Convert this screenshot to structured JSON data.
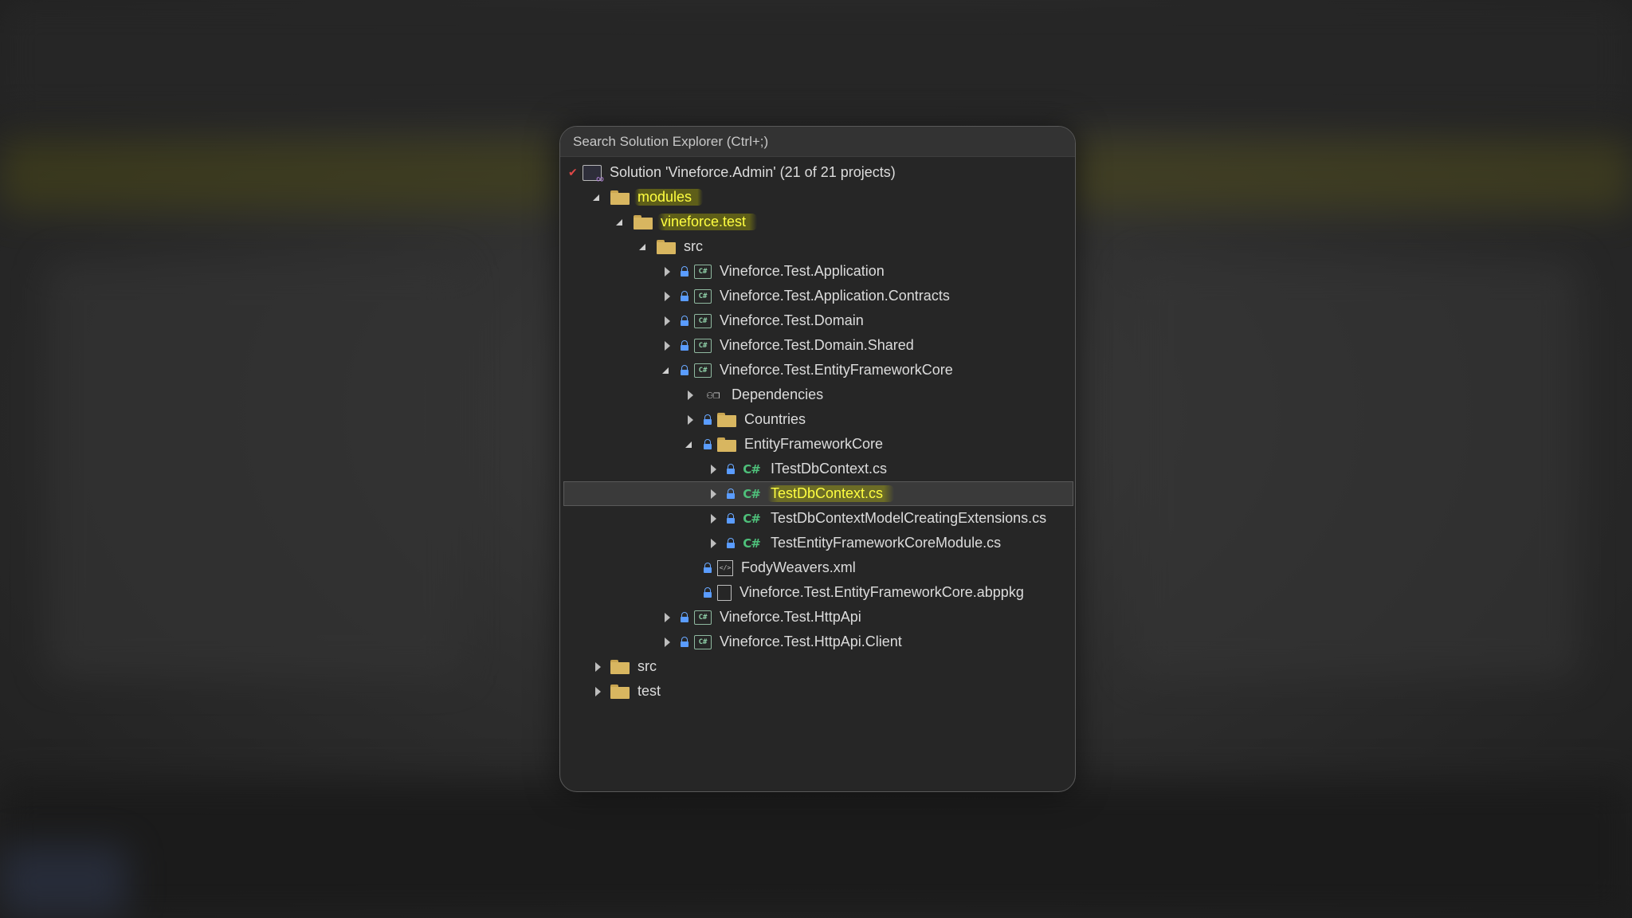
{
  "search": {
    "placeholder": "Search Solution Explorer (Ctrl+;)"
  },
  "tree": [
    {
      "label": "Solution 'Vineforce.Admin' (21 of 21 projects)",
      "icon": "solution-icon",
      "expand": "none",
      "lock": false,
      "level": 0,
      "check": true
    },
    {
      "label": "modules",
      "icon": "folder-icon",
      "expand": "expanded",
      "lock": false,
      "level": 1,
      "highlight": true
    },
    {
      "label": "vineforce.test",
      "icon": "folder-icon",
      "expand": "expanded",
      "lock": false,
      "level": 2,
      "highlight": true
    },
    {
      "label": "src",
      "icon": "folder-icon",
      "expand": "expanded",
      "lock": false,
      "level": 3
    },
    {
      "label": "Vineforce.Test.Application",
      "icon": "csproj-icon",
      "expand": "collapsed",
      "lock": true,
      "level": 4
    },
    {
      "label": "Vineforce.Test.Application.Contracts",
      "icon": "csproj-icon",
      "expand": "collapsed",
      "lock": true,
      "level": 4
    },
    {
      "label": "Vineforce.Test.Domain",
      "icon": "csproj-icon",
      "expand": "collapsed",
      "lock": true,
      "level": 4
    },
    {
      "label": "Vineforce.Test.Domain.Shared",
      "icon": "csproj-icon",
      "expand": "collapsed",
      "lock": true,
      "level": 4
    },
    {
      "label": "Vineforce.Test.EntityFrameworkCore",
      "icon": "csproj-icon",
      "expand": "expanded",
      "lock": true,
      "level": 4
    },
    {
      "label": "Dependencies",
      "icon": "dependencies-icon",
      "expand": "collapsed",
      "lock": false,
      "level": 5
    },
    {
      "label": "Countries",
      "icon": "folder-icon",
      "expand": "collapsed",
      "lock": true,
      "level": 5
    },
    {
      "label": "EntityFrameworkCore",
      "icon": "folder-icon",
      "expand": "expanded",
      "lock": true,
      "level": 5
    },
    {
      "label": "ITestDbContext.cs",
      "icon": "csharp-file-icon",
      "expand": "collapsed",
      "lock": true,
      "level": 6
    },
    {
      "label": "TestDbContext.cs",
      "icon": "csharp-file-icon",
      "expand": "collapsed",
      "lock": true,
      "level": 6,
      "selected": true,
      "highlight": true
    },
    {
      "label": "TestDbContextModelCreatingExtensions.cs",
      "icon": "csharp-file-icon",
      "expand": "collapsed",
      "lock": true,
      "level": 6
    },
    {
      "label": "TestEntityFrameworkCoreModule.cs",
      "icon": "csharp-file-icon",
      "expand": "collapsed",
      "lock": true,
      "level": 6
    },
    {
      "label": "FodyWeavers.xml",
      "icon": "xml-file-icon",
      "expand": "none",
      "lock": true,
      "level": 5
    },
    {
      "label": "Vineforce.Test.EntityFrameworkCore.abppkg",
      "icon": "file-icon",
      "expand": "none",
      "lock": true,
      "level": 5
    },
    {
      "label": "Vineforce.Test.HttpApi",
      "icon": "csproj-icon",
      "expand": "collapsed",
      "lock": true,
      "level": 4
    },
    {
      "label": "Vineforce.Test.HttpApi.Client",
      "icon": "csproj-icon",
      "expand": "collapsed",
      "lock": true,
      "level": 4
    },
    {
      "label": "src",
      "icon": "folder-icon",
      "expand": "collapsed",
      "lock": false,
      "level": 1
    },
    {
      "label": "test",
      "icon": "folder-icon",
      "expand": "collapsed",
      "lock": false,
      "level": 1
    }
  ]
}
